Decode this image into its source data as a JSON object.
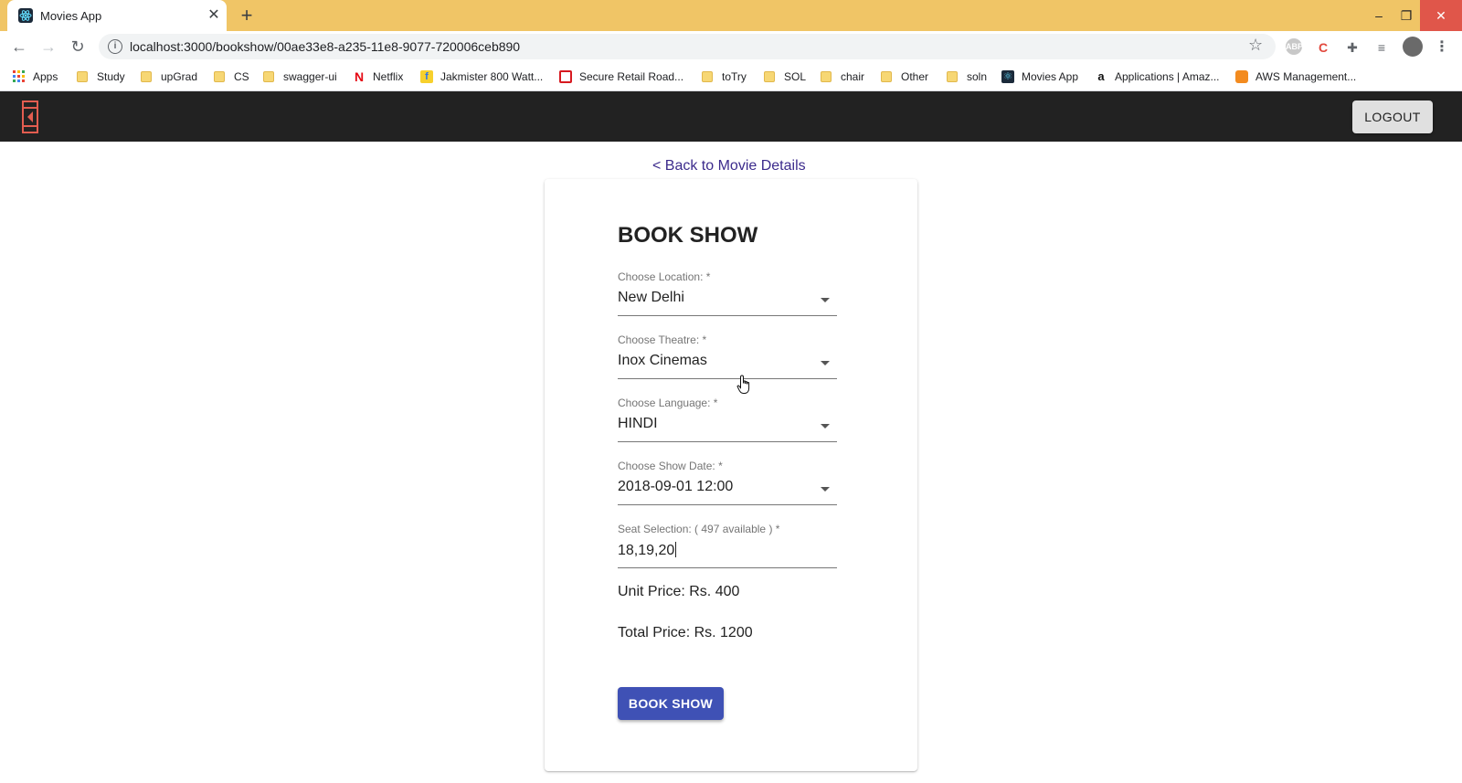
{
  "browser": {
    "tab_title": "Movies App",
    "tab_close": "✕",
    "new_tab": "+",
    "url": "localhost:3000/bookshow/00ae33e8-a235-11e8-9077-720006ceb890",
    "window_controls": {
      "minimize": "–",
      "maximize": "❐",
      "close": "✕"
    }
  },
  "bookmarks": [
    {
      "label": "Apps",
      "icon": "apps-grid-icon"
    },
    {
      "label": "Study",
      "icon": "folder-icon"
    },
    {
      "label": "upGrad",
      "icon": "folder-icon"
    },
    {
      "label": "CS",
      "icon": "folder-icon"
    },
    {
      "label": "swagger-ui",
      "icon": "folder-icon"
    },
    {
      "label": "Netflix",
      "icon": "netflix-icon"
    },
    {
      "label": "Jakmister 800 Watt...",
      "icon": "flipkart-icon"
    },
    {
      "label": "Secure Retail Road...",
      "icon": "bank-icon"
    },
    {
      "label": "toTry",
      "icon": "folder-icon"
    },
    {
      "label": "SOL",
      "icon": "folder-icon"
    },
    {
      "label": "chair",
      "icon": "folder-icon"
    },
    {
      "label": "Other",
      "icon": "folder-icon"
    },
    {
      "label": "soln",
      "icon": "folder-icon"
    },
    {
      "label": "Movies App",
      "icon": "react-icon"
    },
    {
      "label": "Applications | Amaz...",
      "icon": "amazon-icon"
    },
    {
      "label": "AWS Management...",
      "icon": "aws-icon"
    }
  ],
  "header": {
    "logout_label": "LOGOUT"
  },
  "page": {
    "back_link": "< Back to Movie Details",
    "title": "BOOK SHOW",
    "fields": {
      "location": {
        "label": "Choose Location: *",
        "value": "New Delhi"
      },
      "theatre": {
        "label": "Choose Theatre: *",
        "value": "Inox Cinemas"
      },
      "language": {
        "label": "Choose Language: *",
        "value": "HINDI"
      },
      "show_date": {
        "label": "Choose Show Date: *",
        "value": "2018-09-01 12:00"
      },
      "seats": {
        "label": "Seat Selection: ( 497 available ) *",
        "value": "18,19,20"
      }
    },
    "unit_price": "Unit Price: Rs. 400",
    "total_price": "Total Price: Rs. 1200",
    "book_button": "BOOK SHOW"
  },
  "colors": {
    "titlebar": "#f0c566",
    "appbar": "#222222",
    "primary": "#3f51b5",
    "link": "#3c2b8c"
  }
}
